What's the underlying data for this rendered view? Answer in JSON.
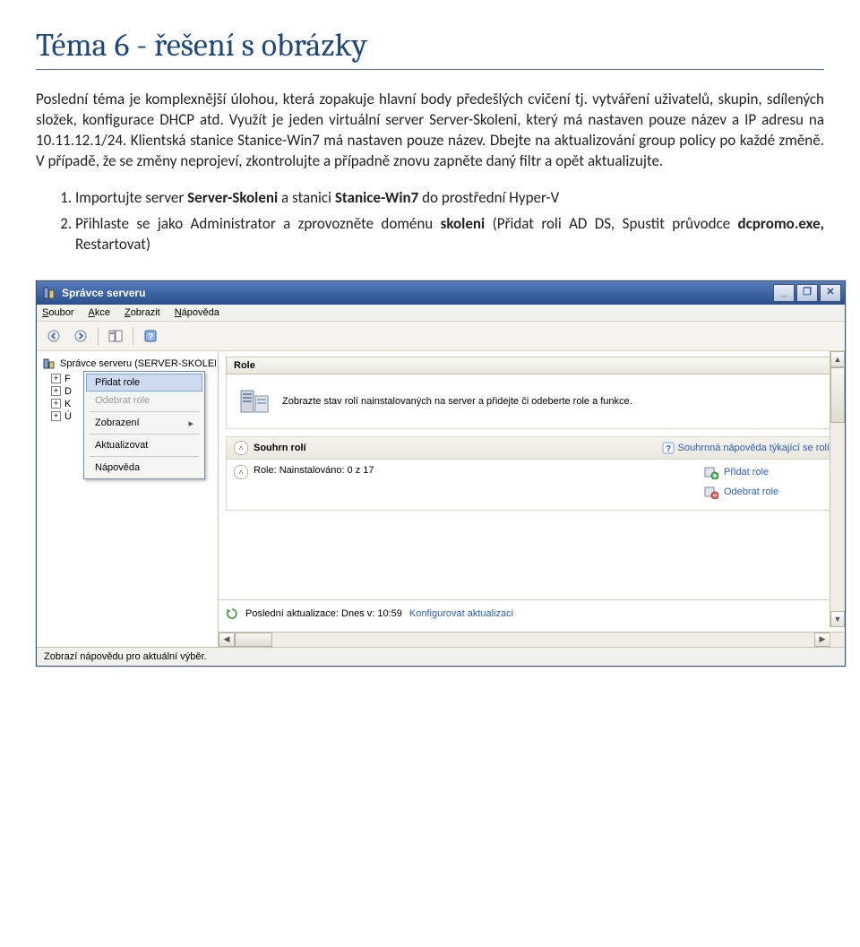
{
  "doc": {
    "heading": "Téma 6 - řešení s obrázky",
    "para": "Poslední téma je komplexnější úlohou, která zopakuje hlavní body předešlých cvičení tj. vytváření uživatelů, skupin, sdílených složek, konfigurace DHCP atd. Využít je jeden virtuální server Server-Skoleni, který má nastaven pouze název a IP adresu na 10.11.12.1/24. Klientská stanice Stanice-Win7 má nastaven pouze název. Dbejte na aktualizování group policy po každé změně. V případě, že se změny neprojeví, zkontrolujte a případně znovu zapněte daný filtr a opět aktualizujte.",
    "step1_a": "Importujte server ",
    "step1_b": "Server-Skoleni",
    "step1_c": " a stanici ",
    "step1_d": "Stanice-Win7",
    "step1_e": " do prostřední Hyper-V",
    "step2_a": "Přihlaste se jako Administrator a zprovozněte doménu ",
    "step2_b": "skoleni",
    "step2_c": " (Přidat roli AD DS, Spustit průvodce ",
    "step2_d": "dcpromo.exe,",
    "step2_e": " Restartovat)"
  },
  "win": {
    "title": "Správce serveru",
    "menu": {
      "soubor": "Soubor",
      "akce": "Akce",
      "zobrazit": "Zobrazit",
      "napoveda": "Nápověda"
    },
    "tree_root": "Správce serveru (SERVER-SKOLENI",
    "tree_stub": [
      "F",
      "D",
      "K",
      "Ú"
    ],
    "ctx": {
      "pridat": "Přidat role",
      "odebrat": "Odebrat role",
      "zobrazeni": "Zobrazení",
      "aktualizovat": "Aktualizovat",
      "napoveda": "Nápověda"
    },
    "content": {
      "header": "Role",
      "intro": "Zobrazte stav rolí nainstalovaných na server a přidejte či odeberte role a funkce.",
      "summary_title": "Souhrn rolí",
      "summary_help": "Souhrnná nápověda týkající se rolí",
      "roles_label": "Role: Nainstalováno: 0 z 17",
      "action_add": "Přidat role",
      "action_remove": "Odebrat role",
      "last_update_label": "Poslední aktualizace: Dnes v: 10:59",
      "configure": "Konfigurovat aktualizaci"
    },
    "status": "Zobrazí nápovědu pro aktuální výběr."
  }
}
